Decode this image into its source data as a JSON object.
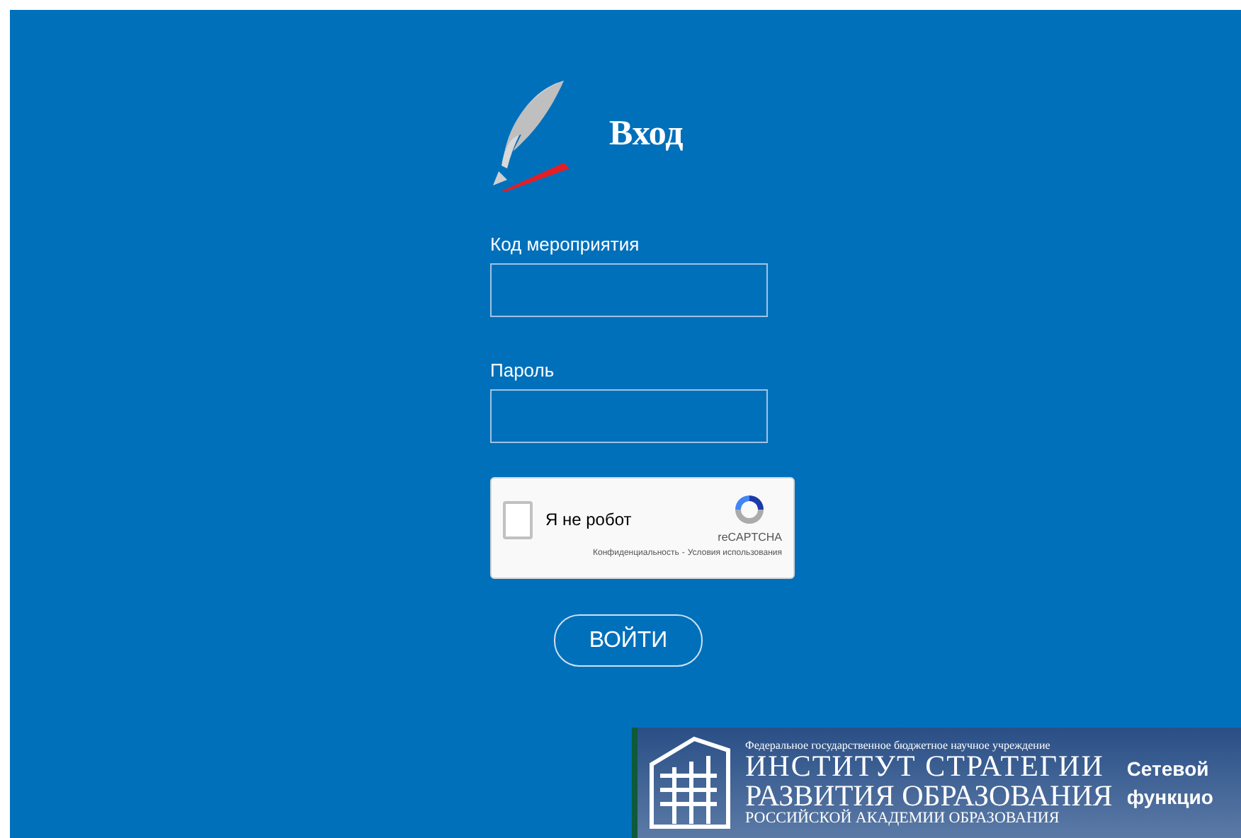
{
  "title": "Вход",
  "fields": [
    {
      "label": "Код мероприятия"
    },
    {
      "label": "Пароль"
    }
  ],
  "captcha": {
    "label": "Я не робот",
    "checked": false,
    "brand": "reCAPTCHA",
    "privacy": "Конфиденциальность",
    "separator": "-",
    "terms": "Условия использования"
  },
  "submit": "ВОЙТИ",
  "banner": {
    "subtitle": "Федеральное государственное бюджетное научное учреждение",
    "line1": "ИНСТИТУТ СТРАТЕГИИ",
    "line2": "РАЗВИТИЯ ОБРАЗОВАНИЯ",
    "line3": "РОССИЙСКОЙ АКАДЕМИИ ОБРАЗОВАНИЯ",
    "side1": "Сетевой",
    "side2": "функцио"
  }
}
